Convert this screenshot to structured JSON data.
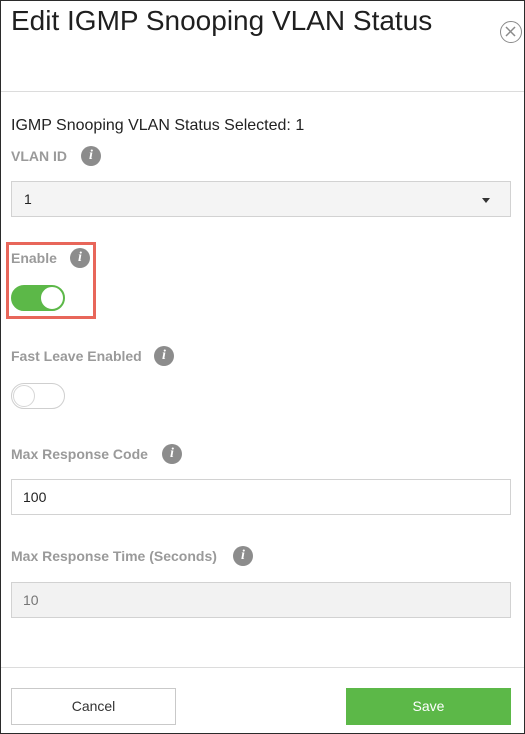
{
  "dialog": {
    "title": "Edit IGMP Snooping VLAN Status",
    "close_icon": "close-circle-icon",
    "selected_text": "IGMP Snooping VLAN Status Selected: 1"
  },
  "fields": {
    "vlan_id": {
      "label": "VLAN ID",
      "value": "1",
      "info_icon": "info-icon"
    },
    "enable": {
      "label": "Enable",
      "state": "on",
      "info_icon": "info-icon"
    },
    "fast_leave": {
      "label": "Fast Leave Enabled",
      "state": "off",
      "info_icon": "info-icon"
    },
    "max_response_code": {
      "label": "Max Response Code",
      "value": "100",
      "info_icon": "info-icon"
    },
    "max_response_time": {
      "label": "Max Response Time (Seconds)",
      "placeholder": "10",
      "disabled": true,
      "info_icon": "info-icon"
    }
  },
  "footer": {
    "cancel_label": "Cancel",
    "save_label": "Save"
  },
  "colors": {
    "toggle_on": "#5cb848",
    "save_button": "#5cb848",
    "highlight": "#e8665a",
    "info_icon": "#8c8c8c"
  }
}
